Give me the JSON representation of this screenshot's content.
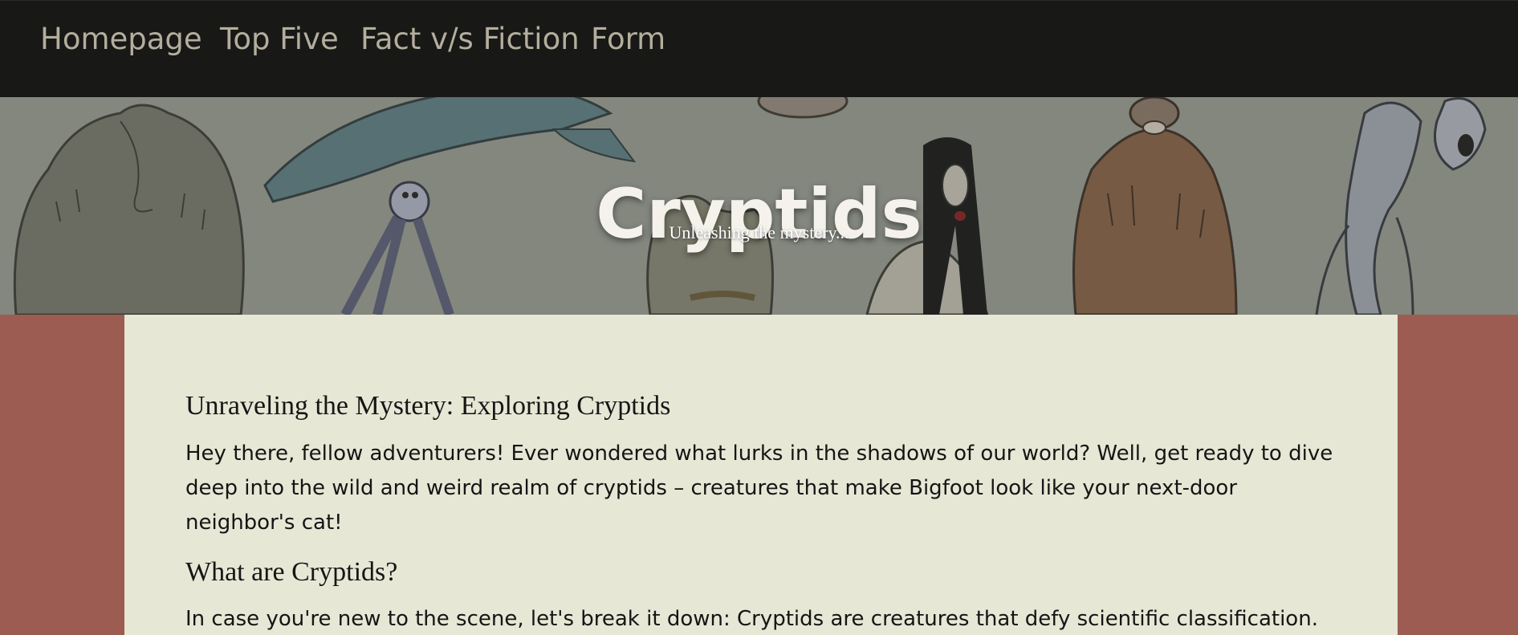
{
  "nav": {
    "items": [
      {
        "label": "Homepage"
      },
      {
        "label": "Top Five"
      },
      {
        "label": "Fact v/s Fiction"
      },
      {
        "label": "Form"
      }
    ]
  },
  "hero": {
    "title": "Cryptids",
    "subtitle": "Unleashing the mystery..."
  },
  "article": {
    "heading1": "Unraveling the Mystery: Exploring Cryptids",
    "intro": "Hey there, fellow adventurers! Ever wondered what lurks in the shadows of our world? Well, get ready to dive deep into the wild and weird realm of cryptids – creatures that make Bigfoot look like your next-door neighbor's cat!",
    "heading2": "What are Cryptids?",
    "definition": "In case you're new to the scene, let's break it down: Cryptids are creatures that defy scientific classification."
  },
  "colors": {
    "navbar_bg": "#181816",
    "nav_text": "#b3ae9d",
    "page_bg": "#9c5c52",
    "content_bg": "#e6e7d5"
  },
  "icons": {
    "hero_art": "cryptid-illustration"
  }
}
